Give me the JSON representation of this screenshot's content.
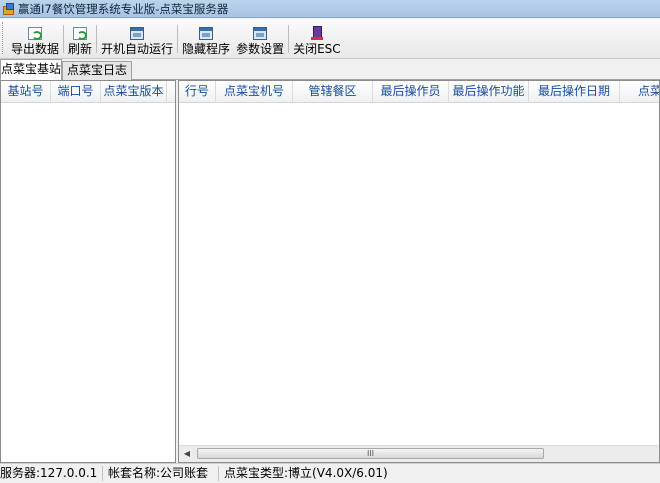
{
  "window": {
    "title": "赢通I7餐饮管理系统专业版-点菜宝服务器"
  },
  "toolbar": {
    "export": "导出数据",
    "refresh": "刷新",
    "autostart": "开机自动运行",
    "hide": "隐藏程序",
    "settings": "参数设置",
    "close": "关闭ESC"
  },
  "tabs": [
    "点菜宝基站",
    "点菜宝日志"
  ],
  "left_list": {
    "columns": [
      "基站号",
      "端口号",
      "点菜宝版本"
    ]
  },
  "right_list": {
    "columns": [
      "行号",
      "点菜宝机号",
      "管辖餐区",
      "最后操作员",
      "最后操作功能",
      "最后操作日期",
      "点菜"
    ]
  },
  "scrollbar": {
    "grip": "III"
  },
  "status": {
    "server": "服务器:127.0.0.1",
    "account": "帐套名称:公司账套",
    "device": "点菜宝类型:博立(V4.0X/6.01)"
  },
  "icons": [
    "export-icon",
    "refresh-icon",
    "autostart-icon",
    "hide-icon",
    "settings-icon",
    "exit-icon"
  ]
}
